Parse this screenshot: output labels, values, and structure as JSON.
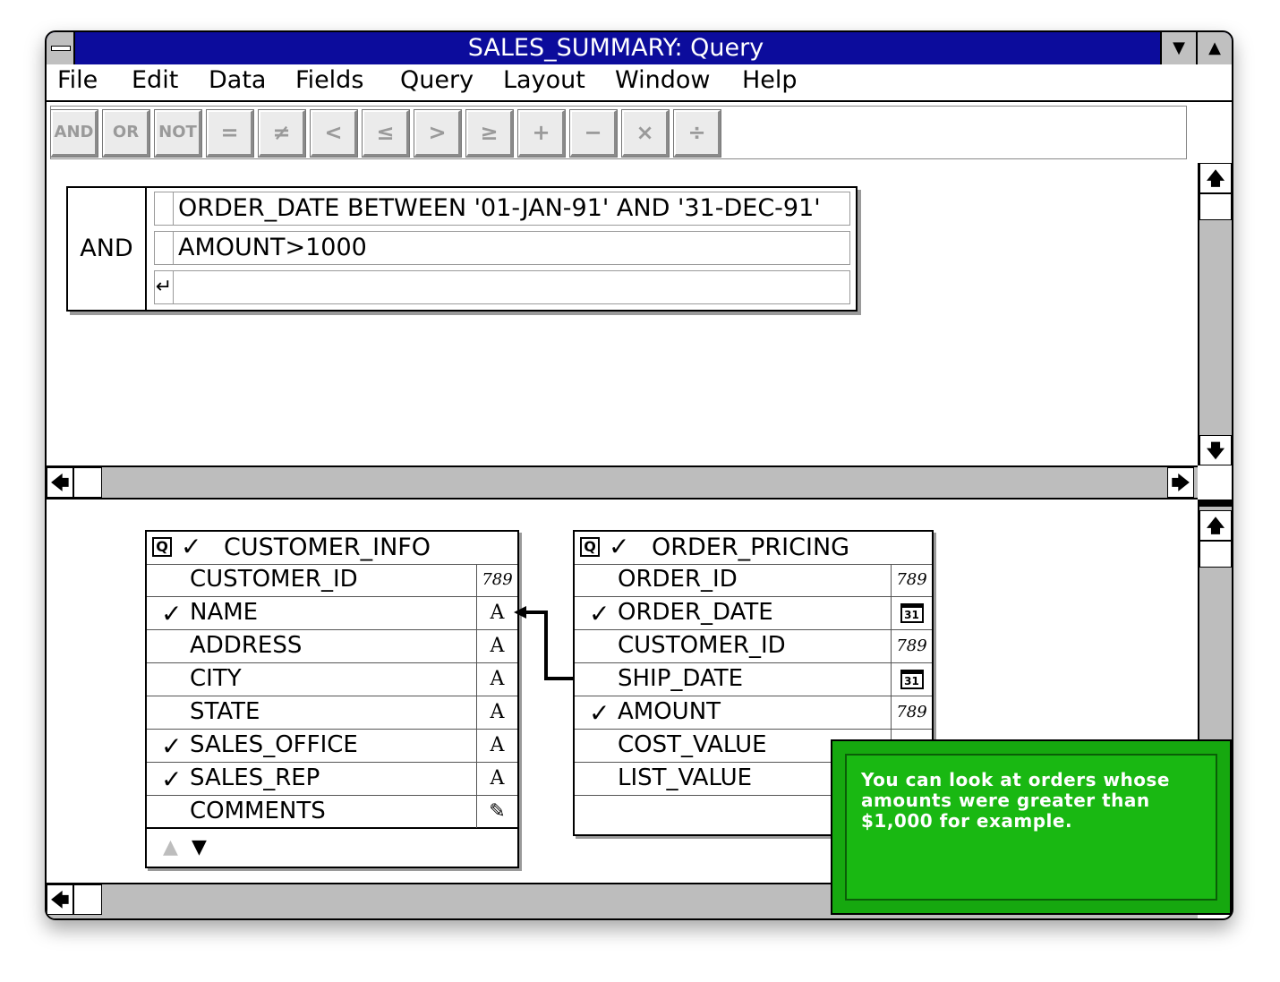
{
  "window": {
    "title": "SALES_SUMMARY: Query",
    "minimize_glyph": "▼",
    "maximize_glyph": "▲"
  },
  "menubar": [
    "File",
    "Edit",
    "Data",
    "Fields",
    "Query",
    "Layout",
    "Window",
    "Help"
  ],
  "toolbar": {
    "operators": [
      "AND",
      "OR",
      "NOT",
      "=",
      "≠",
      "<",
      "≤",
      ">",
      "≥",
      "+",
      "−",
      "×",
      "÷"
    ]
  },
  "criteria": {
    "operator": "AND",
    "rows": [
      {
        "mark": "",
        "text": "ORDER_DATE BETWEEN '01-JAN-91' AND '31-DEC-91'"
      },
      {
        "mark": "",
        "text": "AMOUNT>1000"
      },
      {
        "mark": "↵",
        "text": ""
      }
    ]
  },
  "tables": [
    {
      "name": "CUSTOMER_INFO",
      "query_icon": "Q",
      "header_checked": "✓",
      "fields": [
        {
          "name": "CUSTOMER_ID",
          "checked": "",
          "type": "789",
          "type_icon": "number-type-icon"
        },
        {
          "name": "NAME",
          "checked": "✓",
          "type": "A",
          "type_icon": "text-type-icon"
        },
        {
          "name": "ADDRESS",
          "checked": "",
          "type": "A",
          "type_icon": "text-type-icon"
        },
        {
          "name": "CITY",
          "checked": "",
          "type": "A",
          "type_icon": "text-type-icon"
        },
        {
          "name": "STATE",
          "checked": "",
          "type": "A",
          "type_icon": "text-type-icon"
        },
        {
          "name": "SALES_OFFICE",
          "checked": "✓",
          "type": "A",
          "type_icon": "text-type-icon"
        },
        {
          "name": "SALES_REP",
          "checked": "✓",
          "type": "A",
          "type_icon": "text-type-icon"
        },
        {
          "name": "COMMENTS",
          "checked": "",
          "type": "✎",
          "type_icon": "memo-type-icon"
        }
      ],
      "scroll_up": "▲",
      "scroll_down": "▼"
    },
    {
      "name": "ORDER_PRICING",
      "query_icon": "Q",
      "header_checked": "✓",
      "fields": [
        {
          "name": "ORDER_ID",
          "checked": "",
          "type": "789",
          "type_icon": "number-type-icon"
        },
        {
          "name": "ORDER_DATE",
          "checked": "✓",
          "type": "31",
          "type_icon": "date-type-icon"
        },
        {
          "name": "CUSTOMER_ID",
          "checked": "",
          "type": "789",
          "type_icon": "number-type-icon"
        },
        {
          "name": "SHIP_DATE",
          "checked": "",
          "type": "31",
          "type_icon": "date-type-icon"
        },
        {
          "name": "AMOUNT",
          "checked": "✓",
          "type": "789",
          "type_icon": "number-type-icon"
        },
        {
          "name": "COST_VALUE",
          "checked": "",
          "type": "",
          "type_icon": ""
        },
        {
          "name": "LIST_VALUE",
          "checked": "",
          "type": "",
          "type_icon": ""
        }
      ]
    }
  ],
  "tooltip": {
    "text": "You can look at orders whose amounts were greater than $1,000 for example.",
    "color": "#19b812"
  },
  "scroll_glyphs": {
    "up": "🡅",
    "down": "🡇",
    "left": "🡄",
    "right": "🡆"
  }
}
